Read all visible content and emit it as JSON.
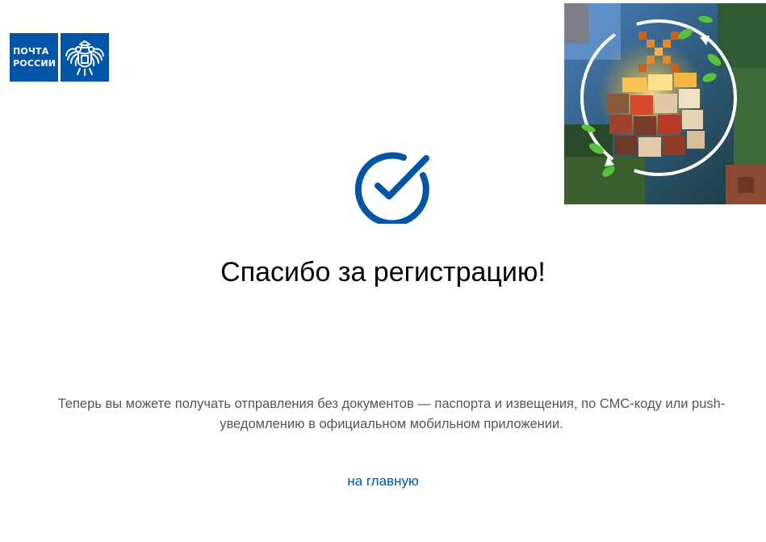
{
  "header": {
    "logo": {
      "line1": "ПОЧТА",
      "line2": "РОССИИ",
      "brand_color": "#0055a6",
      "emblem_icon": "double-headed-eagle-icon"
    },
    "promo_banner": {
      "icon": "minecraft-cube-game-icon"
    }
  },
  "main": {
    "status_icon": "check-circle-icon",
    "accent_color": "#0055a6",
    "title": "Спасибо за регистрацию!",
    "description": "Теперь вы можете получать отправления без документов — паспорта и извещения, по СМС-коду или push-уведомлению в официальном мобильном приложении.",
    "home_link": "на главную"
  }
}
